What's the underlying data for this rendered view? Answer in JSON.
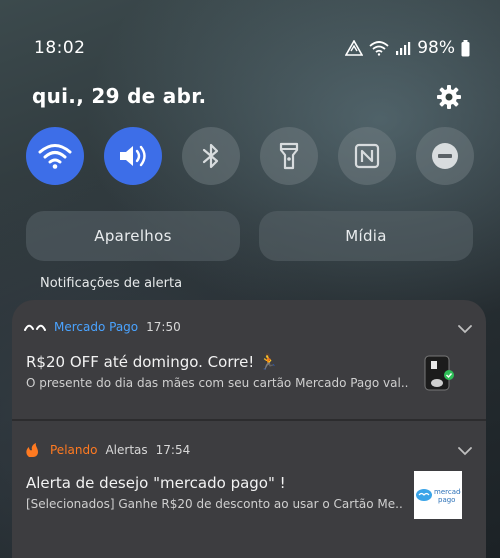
{
  "status": {
    "time": "18:02",
    "battery": "98%"
  },
  "panel": {
    "date": "qui., 29 de abr."
  },
  "quick_toggles": [
    {
      "name": "wifi-icon",
      "active": true
    },
    {
      "name": "sound-icon",
      "active": true
    },
    {
      "name": "bluetooth-icon",
      "active": false
    },
    {
      "name": "flashlight-icon",
      "active": false
    },
    {
      "name": "nfc-icon",
      "active": false
    },
    {
      "name": "do-not-disturb-icon",
      "active": false
    }
  ],
  "buttons": {
    "devices": "Aparelhos",
    "media": "Mídia"
  },
  "notifications_header": "Notificações de alerta",
  "notifications": [
    {
      "app": "Mercado Pago",
      "app_color": "#4aa3ff",
      "time": "17:50",
      "title": "R$20 OFF até domingo. Corre! 🏃",
      "body": "O presente do dia das mães com seu cartão Mercado Pago val.."
    },
    {
      "app": "Pelando",
      "app_color": "#ff7a21",
      "category": "Alertas",
      "time": "17:54",
      "title": "Alerta de desejo \"mercado pago\" !",
      "body": "[Selecionados] Ganhe R$20 de desconto ao usar o Cartão Me..",
      "thumb_text_1": "mercado",
      "thumb_text_2": "pago"
    }
  ],
  "colors": {
    "toggle_active": "#3d6ee8",
    "card_bg": "#3d3d40"
  }
}
